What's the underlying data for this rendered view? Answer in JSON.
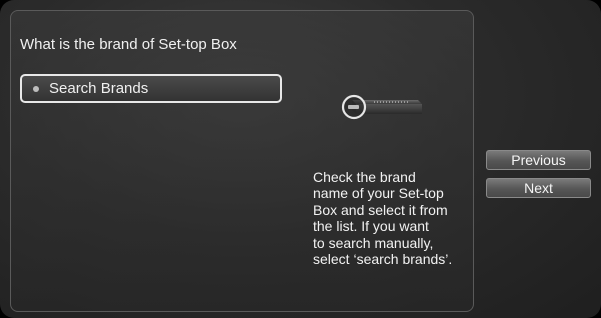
{
  "question": "What is the brand of Set-top Box",
  "search": {
    "label": "Search Brands"
  },
  "help_lines": [
    "Check the brand",
    "name of your Set-top",
    "Box and select it from",
    "the list. If you want",
    "to search manually,",
    "select ‘search brands’."
  ],
  "nav": {
    "previous_label": "Previous",
    "next_label": "Next"
  },
  "icons": {
    "bullet": "bullet-dot-icon",
    "device": "set-top-box-icon"
  }
}
